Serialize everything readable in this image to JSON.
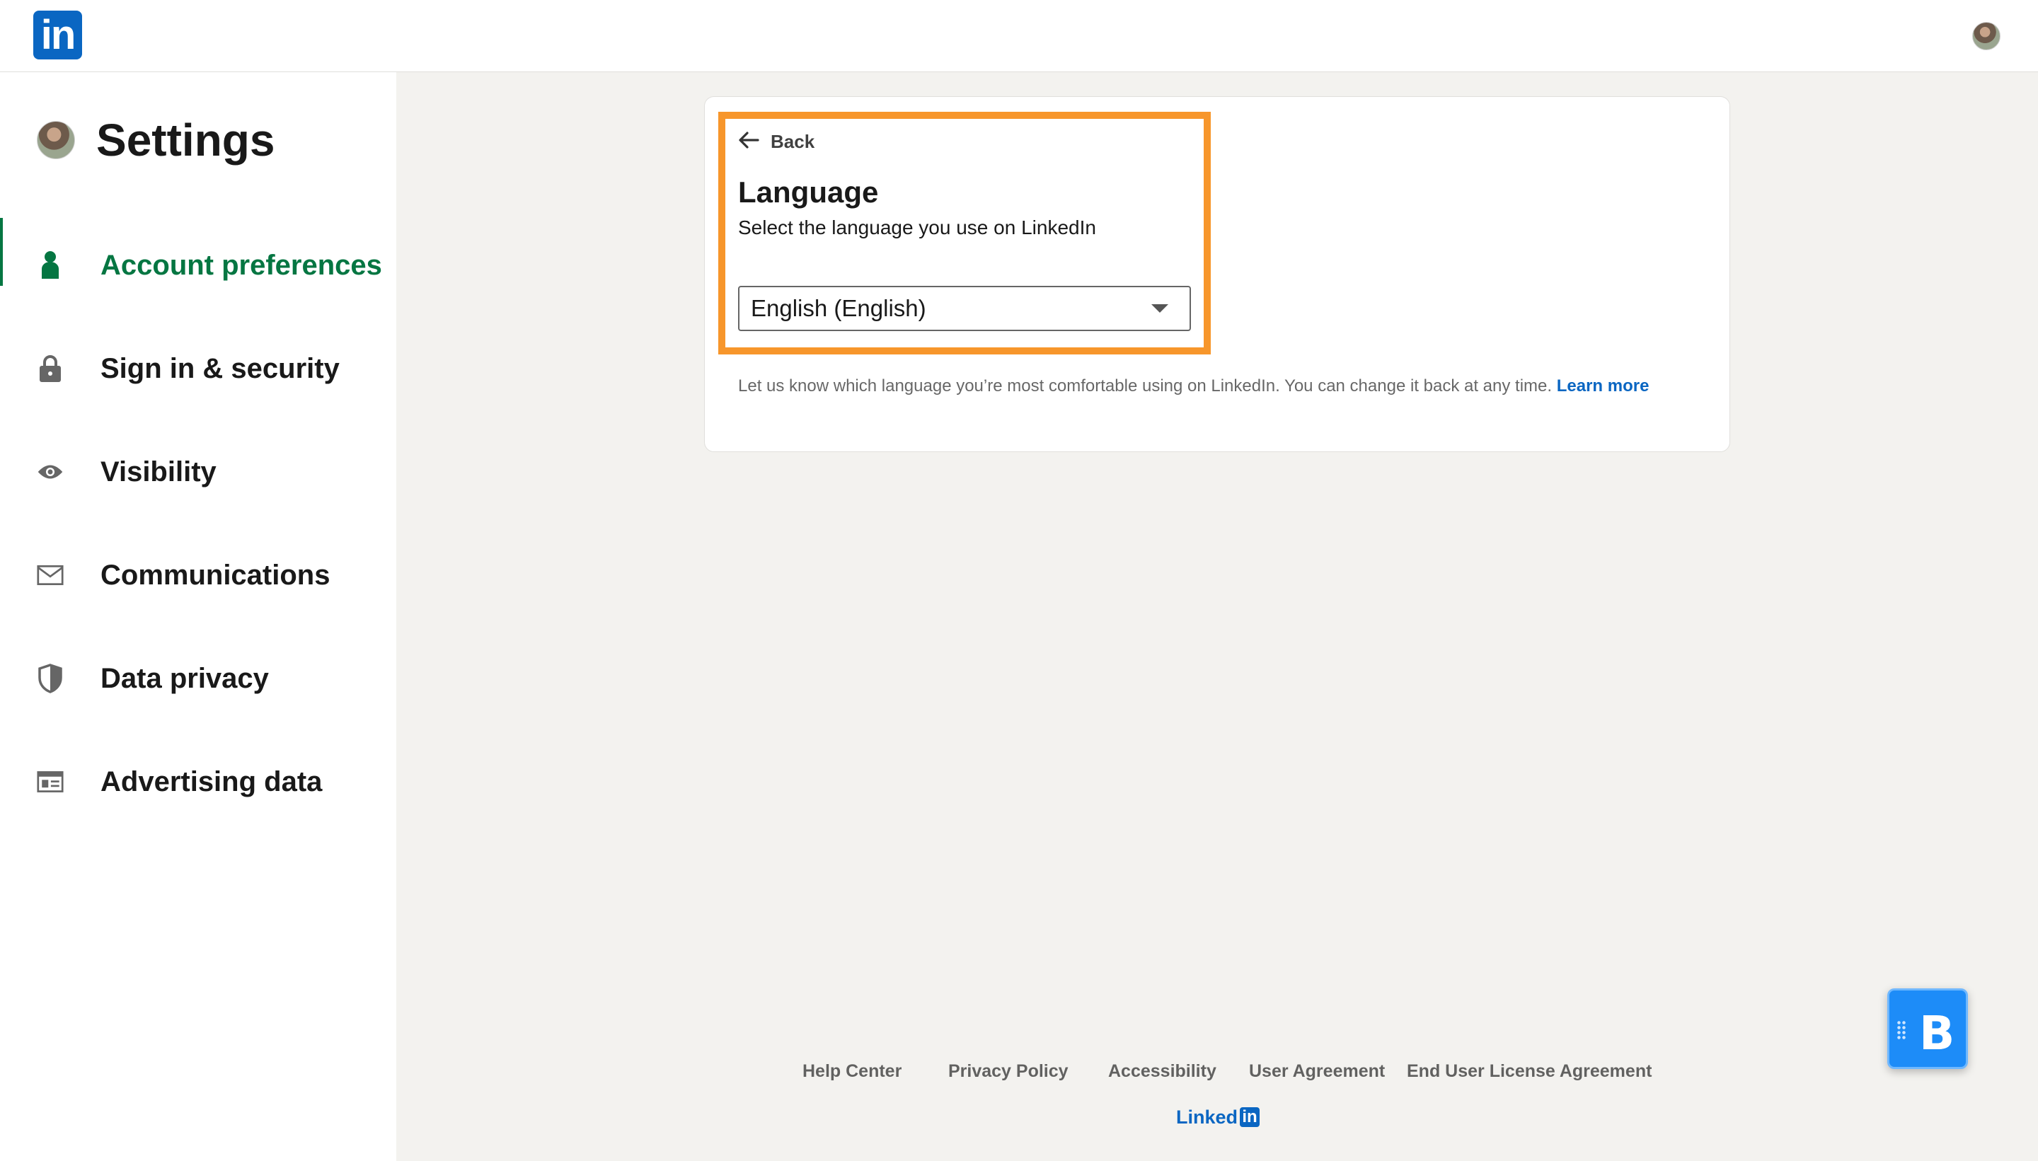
{
  "topbar": {
    "logo_text": "in",
    "avatar_icon": "user-avatar"
  },
  "sidebar": {
    "title": "Settings",
    "items": [
      {
        "label": "Account preferences",
        "icon": "person-icon",
        "active": true
      },
      {
        "label": "Sign in & security",
        "icon": "lock-icon",
        "active": false
      },
      {
        "label": "Visibility",
        "icon": "eye-icon",
        "active": false
      },
      {
        "label": "Communications",
        "icon": "envelope-icon",
        "active": false
      },
      {
        "label": "Data privacy",
        "icon": "shield-icon",
        "active": false
      },
      {
        "label": "Advertising data",
        "icon": "ad-icon",
        "active": false
      }
    ]
  },
  "main": {
    "back_label": "Back",
    "title": "Language",
    "subtitle": "Select the language you use on LinkedIn",
    "select_value": "English (English)",
    "helper_text": "Let us know which language you’re most comfortable using on LinkedIn. You can change it back at any time.",
    "helper_link": "Learn more"
  },
  "footer": {
    "links": [
      "Help Center",
      "Privacy Policy",
      "Accessibility",
      "User Agreement",
      "End User License Agreement"
    ],
    "brand_text": "Linked",
    "brand_in": "in"
  },
  "widget": {
    "letter": "B"
  },
  "colors": {
    "brand_blue": "#0a66c2",
    "active_green": "#057642",
    "highlight_orange": "#f7962b",
    "page_bg": "#f3f2ef"
  }
}
